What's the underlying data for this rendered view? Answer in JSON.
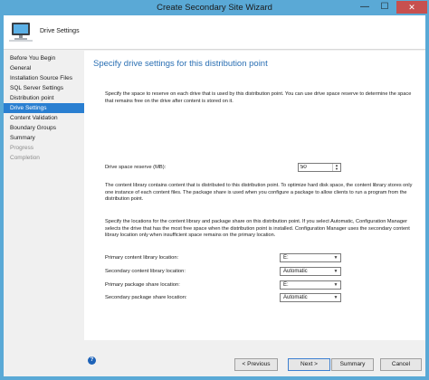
{
  "window": {
    "title": "Create Secondary Site Wizard",
    "minimize_glyph": "—",
    "maximize_glyph": "☐",
    "close_glyph": "✕"
  },
  "header": {
    "icon": "computer-icon",
    "title": "Drive Settings"
  },
  "nav": {
    "items": [
      {
        "label": "Before You Begin",
        "state": "normal"
      },
      {
        "label": "General",
        "state": "normal"
      },
      {
        "label": "Installation Source Files",
        "state": "normal"
      },
      {
        "label": "SQL Server Settings",
        "state": "normal"
      },
      {
        "label": "Distribution point",
        "state": "normal"
      },
      {
        "label": "Drive Settings",
        "state": "active"
      },
      {
        "label": "Content Validation",
        "state": "normal"
      },
      {
        "label": "Boundary Groups",
        "state": "normal"
      },
      {
        "label": "Summary",
        "state": "normal"
      },
      {
        "label": "Progress",
        "state": "disabled"
      },
      {
        "label": "Completion",
        "state": "disabled"
      }
    ]
  },
  "main": {
    "title": "Specify drive settings for this distribution point",
    "para1": "Specify the space to reserve on each drive that is used by this distribution point. You can use drive space reserve to determine the space that remains free on the drive after content is stored on it.",
    "reserve_label": "Drive space reserve (MB):",
    "reserve_value": "50",
    "para2": "The content library contains content that is distributed to this distribution point. To optimize hard disk space, the content library stores only one instance of each content files. The package share is used when you configure a package to allow clients to run a program from the distribution point.",
    "para3": "Specify the locations for the content library and package share on this distribution point. If you select Automatic, Configuration Manager selects the drive that has the most free space when the distribution point is installed. Configuration Manager uses the secondary content library location only when insufficient space remains on the primary location.",
    "locations": [
      {
        "label": "Primary content library location:",
        "value": "E:"
      },
      {
        "label": "Secondary content library location:",
        "value": "Automatic"
      },
      {
        "label": "Primary package share location:",
        "value": "E:"
      },
      {
        "label": "Secondary package share location:",
        "value": "Automatic"
      }
    ]
  },
  "footer": {
    "help_glyph": "?",
    "previous_label": "< Previous",
    "next_label": "Next >",
    "summary_label": "Summary",
    "cancel_label": "Cancel"
  }
}
